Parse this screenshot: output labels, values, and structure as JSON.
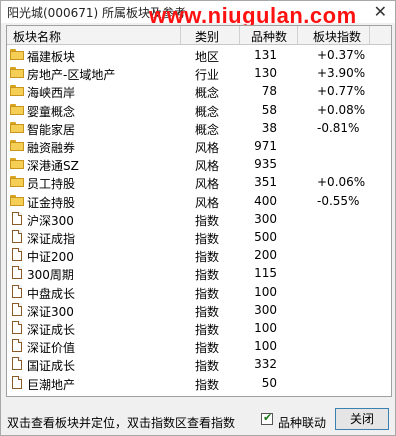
{
  "window": {
    "title": "阳光城(000671) 所属板块及参考",
    "close_glyph": "✕",
    "watermark": "www.niugulan.com"
  },
  "table": {
    "columns": [
      "板块名称",
      "类别",
      "品种数",
      "板块指数"
    ],
    "rows": [
      {
        "icon": "folder",
        "name": "福建板块",
        "type": "地区",
        "count": "131",
        "pct": "+0.37%"
      },
      {
        "icon": "folder",
        "name": "房地产-区域地产",
        "type": "行业",
        "count": "130",
        "pct": "+3.90%"
      },
      {
        "icon": "folder",
        "name": "海峡西岸",
        "type": "概念",
        "count": "78",
        "pct": "+0.77%"
      },
      {
        "icon": "folder",
        "name": "婴童概念",
        "type": "概念",
        "count": "58",
        "pct": "+0.08%"
      },
      {
        "icon": "folder",
        "name": "智能家居",
        "type": "概念",
        "count": "38",
        "pct": "-0.81%"
      },
      {
        "icon": "folder",
        "name": "融资融券",
        "type": "风格",
        "count": "971",
        "pct": ""
      },
      {
        "icon": "folder",
        "name": "深港通SZ",
        "type": "风格",
        "count": "935",
        "pct": ""
      },
      {
        "icon": "folder",
        "name": "员工持股",
        "type": "风格",
        "count": "351",
        "pct": "+0.06%"
      },
      {
        "icon": "folder",
        "name": "证金持股",
        "type": "风格",
        "count": "400",
        "pct": "-0.55%"
      },
      {
        "icon": "doc",
        "name": "沪深300",
        "type": "指数",
        "count": "300",
        "pct": ""
      },
      {
        "icon": "doc",
        "name": "深证成指",
        "type": "指数",
        "count": "500",
        "pct": ""
      },
      {
        "icon": "doc",
        "name": "中证200",
        "type": "指数",
        "count": "200",
        "pct": ""
      },
      {
        "icon": "doc",
        "name": "300周期",
        "type": "指数",
        "count": "115",
        "pct": ""
      },
      {
        "icon": "doc",
        "name": "中盘成长",
        "type": "指数",
        "count": "100",
        "pct": ""
      },
      {
        "icon": "doc",
        "name": "深证300",
        "type": "指数",
        "count": "300",
        "pct": ""
      },
      {
        "icon": "doc",
        "name": "深证成长",
        "type": "指数",
        "count": "100",
        "pct": ""
      },
      {
        "icon": "doc",
        "name": "深证价值",
        "type": "指数",
        "count": "100",
        "pct": ""
      },
      {
        "icon": "doc",
        "name": "国证成长",
        "type": "指数",
        "count": "332",
        "pct": ""
      },
      {
        "icon": "doc",
        "name": "巨潮地产",
        "type": "指数",
        "count": "50",
        "pct": ""
      }
    ]
  },
  "footer": {
    "hint": "双击查看板块并定位，双击指数区查看指数",
    "checkbox_label": "品种联动",
    "checkbox_checked": true,
    "close_label": "关闭"
  },
  "colors": {
    "folder_fill": "#f5cf55",
    "folder_border": "#c8961c",
    "doc_border": "#8a5a28",
    "watermark": "#ff1111",
    "button_border": "#3c7fb1"
  }
}
